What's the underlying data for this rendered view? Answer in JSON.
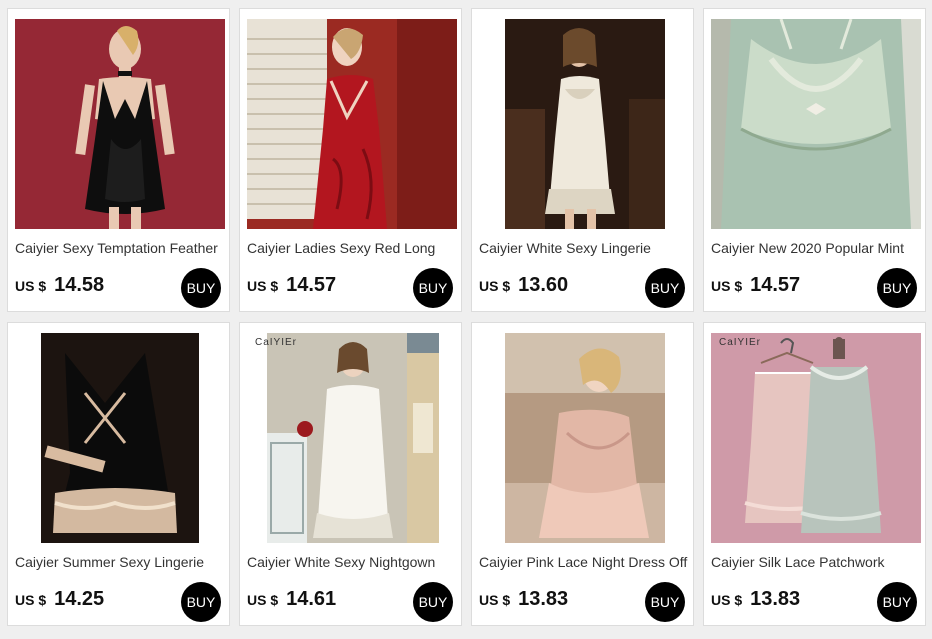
{
  "buy_label": "BUY",
  "currency_label": "US $",
  "products": [
    {
      "title": "Caiyier Sexy Temptation Feather",
      "price": "14.58",
      "image": "black-satin-slip-dress-photo"
    },
    {
      "title": "Caiyier Ladies Sexy Red Long",
      "price": "14.57",
      "image": "red-lace-nightgown-photo"
    },
    {
      "title": "Caiyier White Sexy Lingerie",
      "price": "13.60",
      "image": "white-lace-babydoll-photo"
    },
    {
      "title": "Caiyier New 2020 Popular Mint",
      "price": "14.57",
      "image": "mint-lace-slip-photo"
    },
    {
      "title": "Caiyier Summer Sexy Lingerie",
      "price": "14.25",
      "image": "black-lace-trim-slip-photo"
    },
    {
      "title": "Caiyier White Sexy Nightgown",
      "price": "14.61",
      "image": "white-lace-nightgown-photo",
      "brand_mark": "CaIYIEr"
    },
    {
      "title": "Caiyier Pink Lace Night Dress Off",
      "price": "13.83",
      "image": "pink-lace-night-dress-photo"
    },
    {
      "title": "Caiyier Silk Lace Patchwork",
      "price": "13.83",
      "image": "lace-dresses-on-hangers-photo",
      "brand_mark": "CaIYIEr"
    }
  ]
}
